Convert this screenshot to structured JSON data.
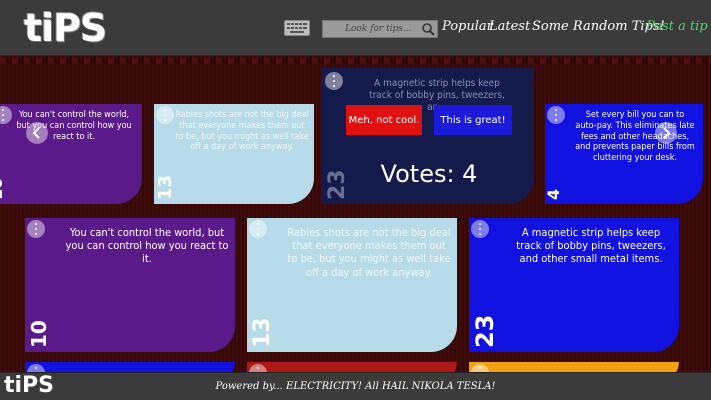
{
  "header": {
    "logo": "tiPS",
    "search_placeholder": "Look for tips...",
    "nav": [
      "Popular",
      "Latest",
      "Some Random Tips!"
    ],
    "post_label": "Post a tip"
  },
  "tips": {
    "control": "You can't control the world, but you can control how you react to it.",
    "rabies": "Rabies shots are not the big deal that everyone makes them out to be, but you might as well take off a day of work anyway.",
    "magnetic": "A magnetic strip helps keep track of bobby pins, tweezers, and other small metal items.",
    "bills": "Set every bill you can to auto-pay. This eliminates late fees and other headaches, and prevents paper bills from cluttering your desk.",
    "magnetic_partial": "A magnetic strip helps keep track of bobby pins, tweezers, an..."
  },
  "numbers": {
    "n10": "10",
    "n13": "13",
    "n23": "23",
    "n4": "4"
  },
  "vote": {
    "no_label": "Meh, not cool.",
    "yes_label": "This is great!",
    "votes_text": "Votes: 4"
  },
  "footer": {
    "logo": "tiPS",
    "text": "Powered by... ELECTRICITY! All HAIL NIKOLA TESLA!"
  },
  "colors": {
    "purple": "#5a1a8a",
    "light_blue": "#b7dbe8",
    "blue": "#1111e0",
    "navy": "#141b4a",
    "no_button": "#e01010",
    "yes_button": "#1a1ad8",
    "post_link": "#4fd36a"
  }
}
